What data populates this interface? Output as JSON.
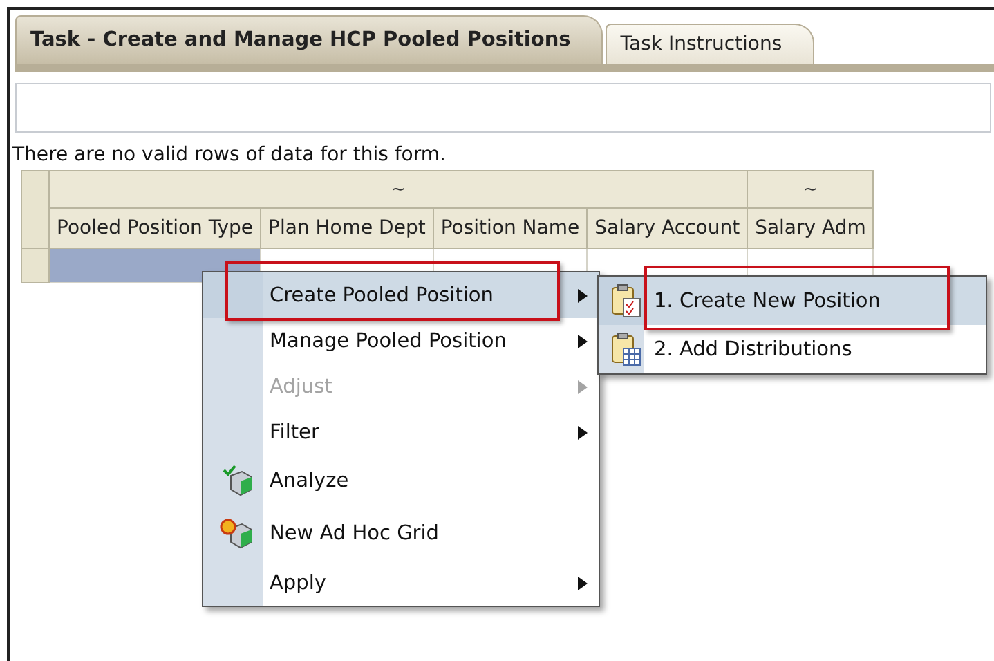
{
  "tabs": [
    {
      "label": "Task - Create and Manage HCP Pooled Positions",
      "selected": true
    },
    {
      "label": "Task Instructions",
      "selected": false
    }
  ],
  "message": "There are no valid rows of data for this form.",
  "grid": {
    "header_groups": [
      {
        "label": "~"
      },
      {
        "label": "~"
      }
    ],
    "columns": [
      "Pooled Position Type",
      "Plan Home Dept",
      "Position Name",
      "Salary Account",
      "Salary Adm"
    ],
    "rows": [
      {
        "cells": [
          {
            "selected": true
          },
          {
            "selected": false
          },
          {
            "selected": false
          },
          {
            "selected": false
          },
          {
            "selected": false
          }
        ]
      }
    ]
  },
  "context_menu": {
    "items": [
      {
        "label": "Create Pooled Position",
        "kind": "submenu",
        "selected": true,
        "disabled": false,
        "highlighted": true
      },
      {
        "label": "Manage Pooled Position",
        "kind": "submenu",
        "selected": false,
        "disabled": false,
        "highlighted": false
      },
      {
        "label": "Adjust",
        "kind": "submenu",
        "selected": false,
        "disabled": true,
        "highlighted": false
      },
      {
        "label": "Filter",
        "kind": "submenu",
        "selected": false,
        "disabled": false,
        "highlighted": false
      },
      {
        "label": "Analyze",
        "kind": "analyze",
        "selected": false,
        "disabled": false,
        "highlighted": false
      },
      {
        "label": "New Ad Hoc Grid",
        "kind": "adhoc",
        "selected": false,
        "disabled": false,
        "highlighted": false
      },
      {
        "label": "Apply",
        "kind": "submenu",
        "selected": false,
        "disabled": false,
        "highlighted": false
      }
    ]
  },
  "submenu": {
    "items": [
      {
        "label": "1. Create New Position",
        "kind": "checklist",
        "selected": true,
        "highlighted": true
      },
      {
        "label": "2. Add Distributions",
        "kind": "table",
        "selected": false,
        "highlighted": false
      }
    ]
  }
}
